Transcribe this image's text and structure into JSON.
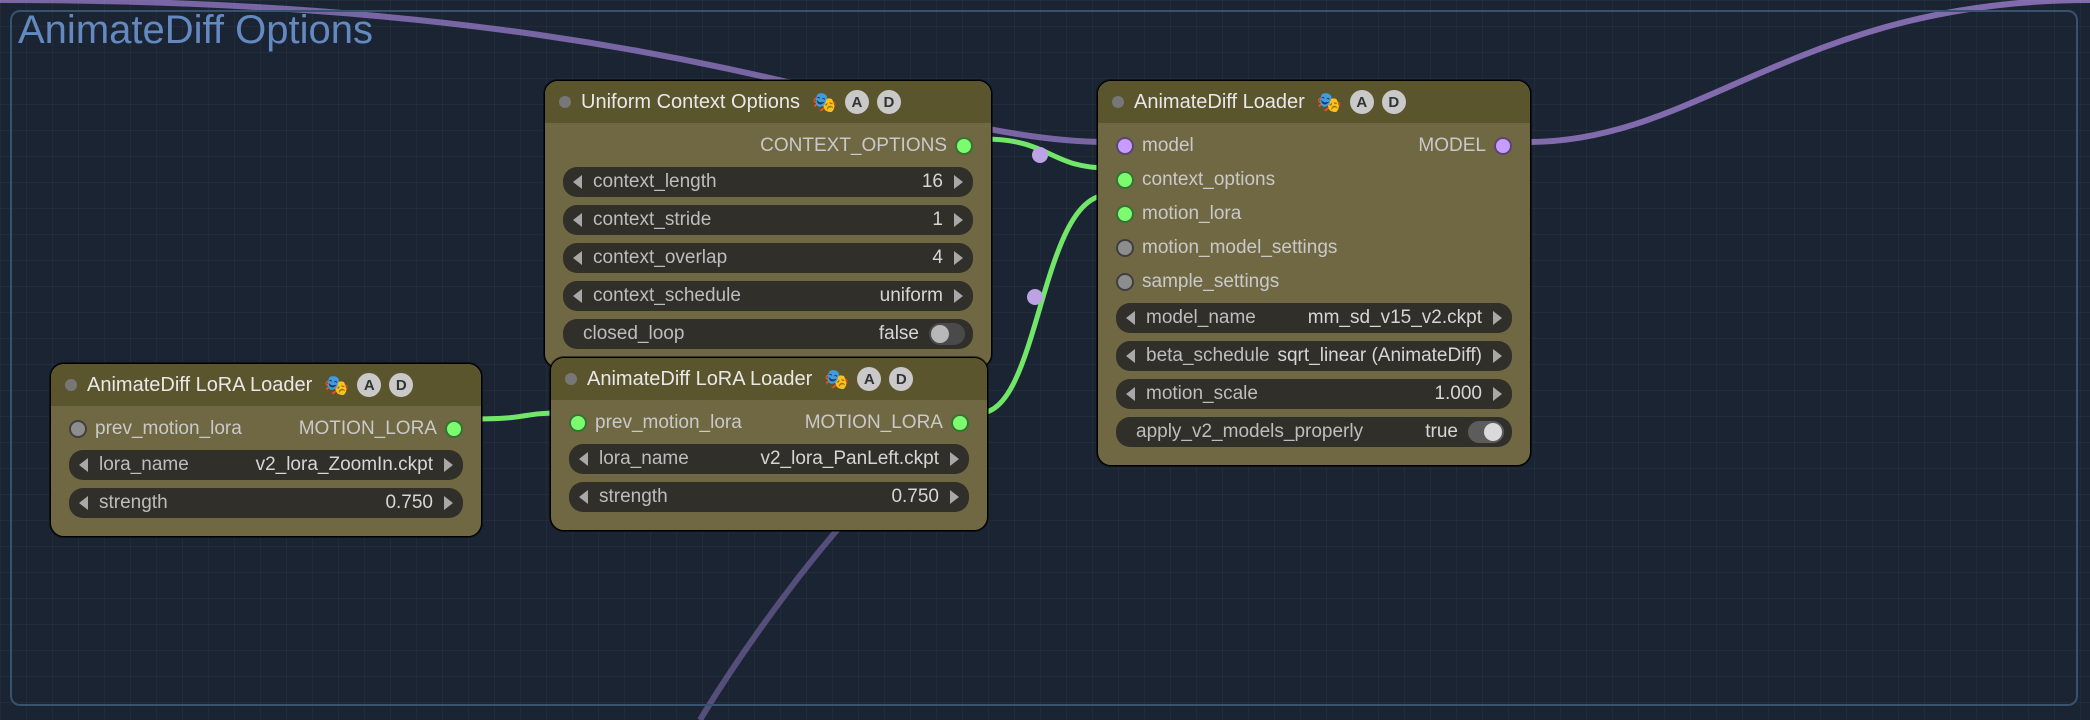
{
  "group_title": "AnimateDiff Options",
  "badge": {
    "a": "A",
    "d": "D",
    "emoji": "🎭"
  },
  "nodes": {
    "context": {
      "title": "Uniform Context Options",
      "outputs": {
        "context_options": "CONTEXT_OPTIONS"
      },
      "widgets": {
        "context_length": {
          "label": "context_length",
          "value": "16"
        },
        "context_stride": {
          "label": "context_stride",
          "value": "1"
        },
        "context_overlap": {
          "label": "context_overlap",
          "value": "4"
        },
        "context_schedule": {
          "label": "context_schedule",
          "value": "uniform"
        },
        "closed_loop": {
          "label": "closed_loop",
          "value": "false",
          "on": false
        }
      }
    },
    "loader": {
      "title": "AnimateDiff Loader",
      "inputs": {
        "model": "model",
        "context_options": "context_options",
        "motion_lora": "motion_lora",
        "motion_model_settings": "motion_model_settings",
        "sample_settings": "sample_settings"
      },
      "outputs": {
        "model": "MODEL"
      },
      "widgets": {
        "model_name": {
          "label": "model_name",
          "value": "mm_sd_v15_v2.ckpt"
        },
        "beta_schedule": {
          "label": "beta_schedule",
          "value": "sqrt_linear (AnimateDiff)"
        },
        "motion_scale": {
          "label": "motion_scale",
          "value": "1.000"
        },
        "apply_v2": {
          "label": "apply_v2_models_properly",
          "value": "true",
          "on": true
        }
      }
    },
    "lora1": {
      "title": "AnimateDiff LoRA Loader",
      "inputs": {
        "prev": "prev_motion_lora"
      },
      "outputs": {
        "motion_lora": "MOTION_LORA"
      },
      "widgets": {
        "lora_name": {
          "label": "lora_name",
          "value": "v2_lora_ZoomIn.ckpt"
        },
        "strength": {
          "label": "strength",
          "value": "0.750"
        }
      }
    },
    "lora2": {
      "title": "AnimateDiff LoRA Loader",
      "inputs": {
        "prev": "prev_motion_lora"
      },
      "outputs": {
        "motion_lora": "MOTION_LORA"
      },
      "widgets": {
        "lora_name": {
          "label": "lora_name",
          "value": "v2_lora_PanLeft.ckpt"
        },
        "strength": {
          "label": "strength",
          "value": "0.750"
        }
      }
    }
  }
}
